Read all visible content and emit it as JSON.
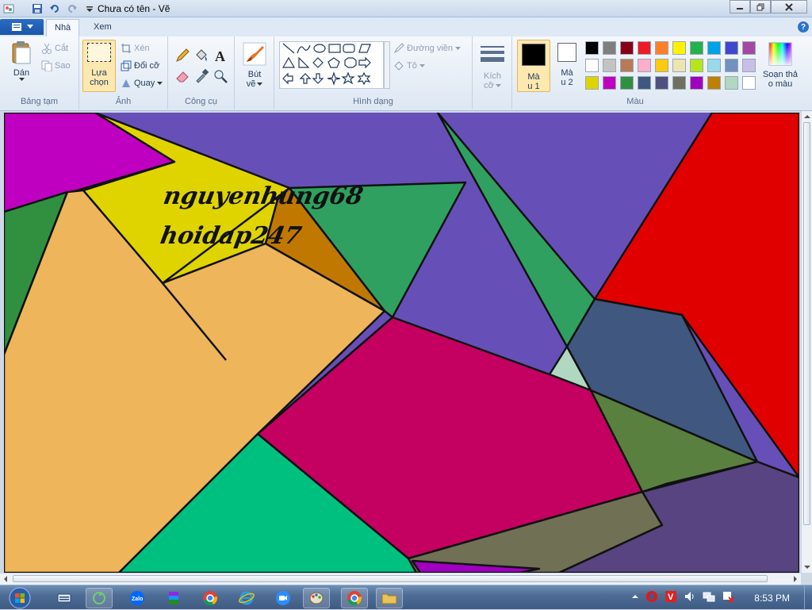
{
  "window": {
    "title": "Chưa có tên - Vẽ"
  },
  "tabs": [
    {
      "label": "Nhà"
    },
    {
      "label": "Xem"
    }
  ],
  "clipboard": {
    "paste": "Dán",
    "cut": "Cắt",
    "copy": "Sao",
    "group": "Bảng tạm"
  },
  "image": {
    "select_line1": "Lựa",
    "select_line2": "chọn",
    "crop": "Xén",
    "resize": "Đổi cỡ",
    "rotate": "Quay",
    "group": "Ảnh"
  },
  "tools": {
    "group": "Công cụ"
  },
  "brushes": {
    "line1": "Bút",
    "line2": "vẽ"
  },
  "shapes": {
    "outline": "Đường viền",
    "fill": "Tô",
    "group": "Hình dạng"
  },
  "size": {
    "line1": "Kích",
    "line2": "cỡ"
  },
  "colors": {
    "color1_line1": "Mà",
    "color1_line2": "u 1",
    "color2_line1": "Mà",
    "color2_line2": "u 2",
    "edit_line1": "Soạn thả",
    "edit_line2": "o màu",
    "group": "Màu",
    "color1_value": "#000000",
    "color2_value": "#ffffff",
    "palette_row1": [
      "#000000",
      "#7f7f7f",
      "#880015",
      "#ed1c24",
      "#ff7f27",
      "#fff200",
      "#22b14c",
      "#00a2e8",
      "#3f48cc",
      "#a349a4"
    ],
    "palette_row2": [
      "#ffffff",
      "#c3c3c3",
      "#b97a57",
      "#ffaec9",
      "#ffc90e",
      "#efe4b0",
      "#b5e61d",
      "#99d9ea",
      "#7092be",
      "#c8bfe7"
    ],
    "palette_row3": [
      "#e0d400",
      "#c000c0",
      "#309040",
      "#405880",
      "#505080",
      "#707060",
      "#a000c0",
      "#c08000",
      "#b0d8c0",
      "#ffffff"
    ]
  },
  "canvas": {
    "text_line1": "nguyenhung68",
    "text_line2": "hoidap247"
  },
  "taskbar": {
    "time": "8:53 PM"
  }
}
